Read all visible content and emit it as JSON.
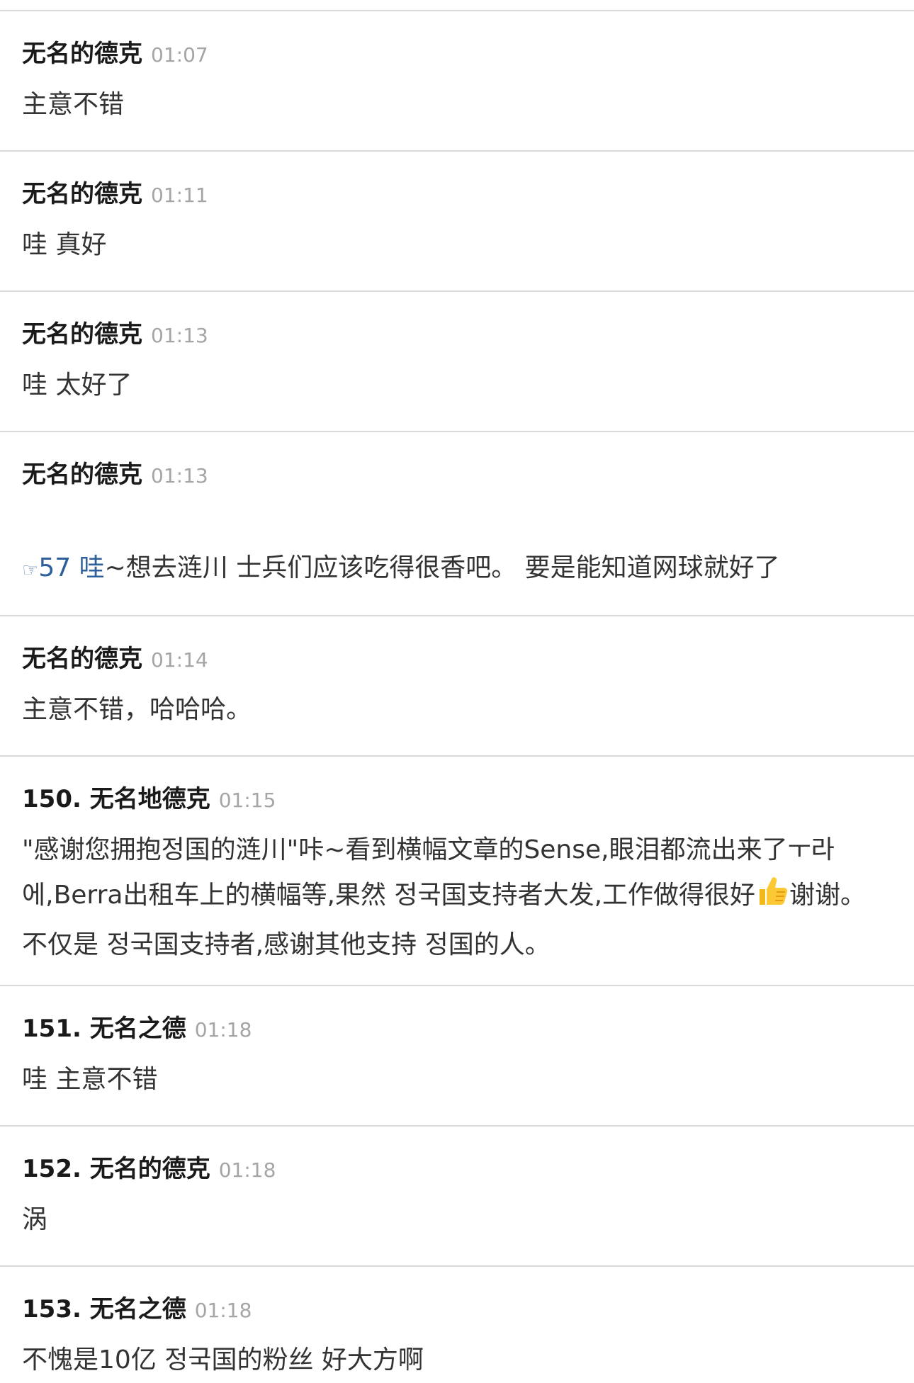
{
  "comments": [
    {
      "author": "无名的德克",
      "time": "01:07",
      "text": "主意不错"
    },
    {
      "author": "无名的德克",
      "time": "01:11",
      "text": "哇 真好"
    },
    {
      "author": "无名的德克",
      "time": "01:13",
      "text": "哇 太好了"
    },
    {
      "author": "无名的德克",
      "time": "01:13",
      "reply_ref": "57",
      "reply_text_accent": "哇",
      "text": "~想去涟川 士兵们应该吃得很香吧。 要是能知道网球就好了"
    },
    {
      "author": "无名的德克",
      "time": "01:14",
      "text": "主意不错，哈哈哈。"
    },
    {
      "author": "150. 无名地德克",
      "time": "01:15",
      "text_line1": "\"感谢您拥抱정国的涟川\"咔~看到横幅文章的Sense,眼泪都流出来了ㅜ라",
      "text_line2a": "에,Berra出租车上的横幅等,果然 정국国支持者大发,工作做得很好",
      "text_line2b": "谢谢。",
      "text_line3": "不仅是 정국国支持者,感谢其他支持 정国的人。",
      "emoji": "thumbs-up-icon"
    },
    {
      "author": "151. 无名之德",
      "time": "01:18",
      "text": "哇 主意不错"
    },
    {
      "author": "152. 无名的德克",
      "time": "01:18",
      "text": "涡"
    },
    {
      "author": "153. 无名之德",
      "time": "01:18",
      "text": "不愧是10亿 정국国的粉丝 好大方啊"
    }
  ]
}
